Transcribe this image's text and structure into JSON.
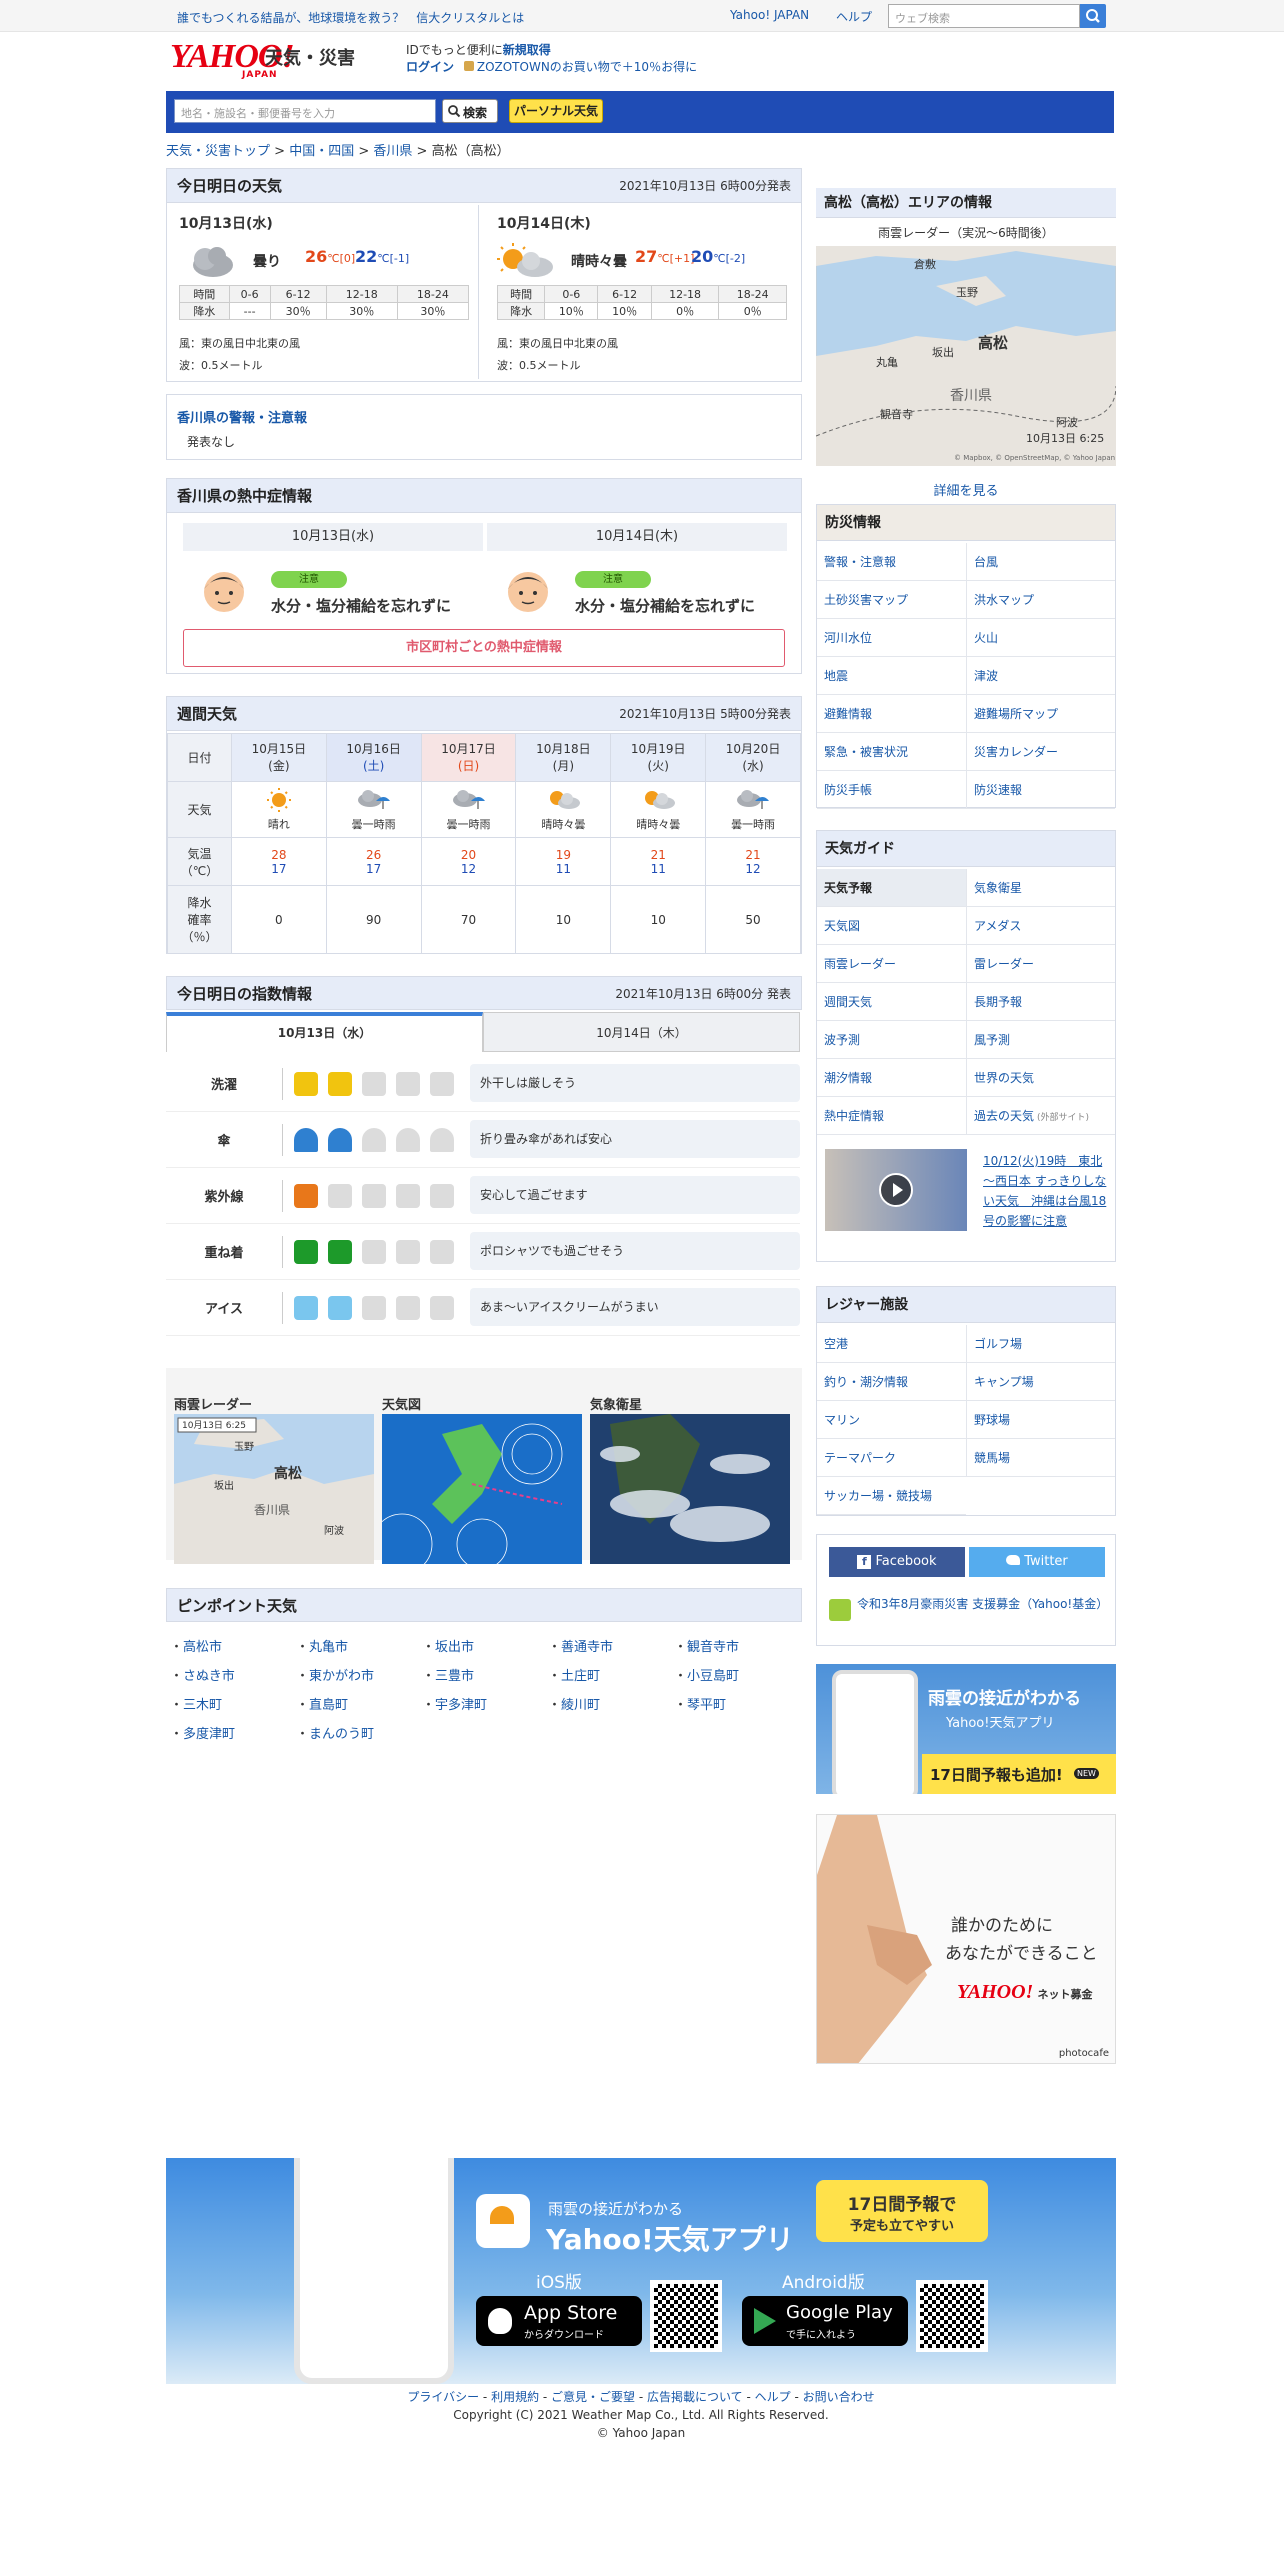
{
  "topbar": {
    "promo": "誰でもつくれる結晶が、地球環境を救う？　信大クリスタルとは",
    "yahoo_japan": "Yahoo! JAPAN",
    "help": "ヘルプ",
    "search_placeholder": "ウェブ検索"
  },
  "header": {
    "logo_text": "YAHOO!",
    "logo_sub": "JAPAN",
    "service": "天気・災害",
    "id_line1_a": "IDでもっと便利に",
    "id_line1_b": "新規取得",
    "login": "ログイン",
    "zozo": "ZOZOTOWNのお買い物で＋10％お得に"
  },
  "searchbar": {
    "placeholder": "地名・施設名・郵便番号を入力",
    "button": "検索",
    "personal": "パーソナル天気"
  },
  "breadcrumb": [
    "天気・災害トップ",
    "中国・四国",
    "香川県",
    "高松（高松）"
  ],
  "today_panel": {
    "title": "今日明日の天気",
    "stamp": "2021年10月13日 6時00分発表",
    "days": [
      {
        "date": "10月13日(水)",
        "cond": "曇り",
        "hi": "26",
        "hi_diff": "℃[0]",
        "lo": "22",
        "lo_diff": "℃[-1]",
        "periods": [
          "時間",
          "0-6",
          "6-12",
          "12-18",
          "18-24"
        ],
        "rain": [
          "降水",
          "---",
          "30％",
          "30％",
          "30％"
        ],
        "wind": "風：東の風日中北東の風",
        "wave": "波：0.5メートル"
      },
      {
        "date": "10月14日(木)",
        "cond": "晴時々曇",
        "hi": "27",
        "hi_diff": "℃[+1]",
        "lo": "20",
        "lo_diff": "℃[-2]",
        "periods": [
          "時間",
          "0-6",
          "6-12",
          "12-18",
          "18-24"
        ],
        "rain": [
          "降水",
          "10％",
          "10％",
          "0％",
          "0％"
        ],
        "wind": "風：東の風日中北東の風",
        "wave": "波：0.5メートル"
      }
    ]
  },
  "warning": {
    "title": "香川県の警報・注意報",
    "text": "発表なし"
  },
  "heat": {
    "title": "香川県の熱中症情報",
    "days": [
      {
        "date": "10月13日(水)",
        "level": "注意",
        "msg": "水分・塩分補給を忘れずに"
      },
      {
        "date": "10月14日(木)",
        "level": "注意",
        "msg": "水分・塩分補給を忘れずに"
      }
    ],
    "link": "市区町村ごとの熱中症情報"
  },
  "weekly": {
    "title": "週間天気",
    "stamp": "2021年10月13日 5時00分発表",
    "labels": {
      "date": "日付",
      "weather": "天気",
      "temp1": "気温",
      "temp2": "（℃）",
      "rain1": "降水",
      "rain2": "確率",
      "rain3": "（％）"
    },
    "days": [
      {
        "date": "10月15日",
        "dow": "(金)",
        "w": "晴れ",
        "hi": "28",
        "lo": "17",
        "rain": "0",
        "icon": "sun"
      },
      {
        "date": "10月16日",
        "dow": "(土)",
        "w": "曇一時雨",
        "hi": "26",
        "lo": "17",
        "rain": "90",
        "icon": "cloudrain"
      },
      {
        "date": "10月17日",
        "dow": "(日)",
        "w": "曇一時雨",
        "hi": "20",
        "lo": "12",
        "rain": "70",
        "icon": "cloudrain"
      },
      {
        "date": "10月18日",
        "dow": "(月)",
        "w": "晴時々曇",
        "hi": "19",
        "lo": "11",
        "rain": "10",
        "icon": "suncloud"
      },
      {
        "date": "10月19日",
        "dow": "(火)",
        "w": "晴時々曇",
        "hi": "21",
        "lo": "11",
        "rain": "10",
        "icon": "suncloud"
      },
      {
        "date": "10月20日",
        "dow": "(水)",
        "w": "曇一時雨",
        "hi": "21",
        "lo": "12",
        "rain": "50",
        "icon": "cloudrain"
      }
    ]
  },
  "index": {
    "title": "今日明日の指数情報",
    "stamp": "2021年10月13日 6時00分 発表",
    "tabs": [
      "10月13日（水）",
      "10月14日（木）"
    ],
    "rows": [
      {
        "name": "洗濯",
        "level": 2,
        "text": "外干しは厳しそう",
        "color": "#f1c40f",
        "icon": "shirt-icon"
      },
      {
        "name": "傘",
        "level": 2,
        "text": "折り畳み傘があれば安心",
        "color": "#2f80d0",
        "icon": "umbrella-icon"
      },
      {
        "name": "紫外線",
        "level": 1,
        "text": "安心して過ごせます",
        "color": "#e8771a",
        "icon": "uv-icon"
      },
      {
        "name": "重ね着",
        "level": 2,
        "text": "ポロシャツでも過ごせそう",
        "color": "#1d9a2a",
        "icon": "sweater-icon"
      },
      {
        "name": "アイス",
        "level": 2,
        "text": "あま～いアイスクリームがうまい",
        "color": "#7ac6ee",
        "icon": "icecream-icon"
      }
    ]
  },
  "maps": {
    "radar": "雨雲レーダー",
    "chart": "天気図",
    "sat": "気象衛星",
    "radar_stamp": "10月13日 6:25",
    "radar_places": [
      "玉野",
      "高松",
      "坂出",
      "香川県",
      "阿波"
    ]
  },
  "pinpoint": {
    "title": "ピンポイント天気",
    "cities": [
      "高松市",
      "丸亀市",
      "坂出市",
      "善通寺市",
      "観音寺市",
      "さぬき市",
      "東かがわ市",
      "三豊市",
      "土庄町",
      "小豆島町",
      "三木町",
      "直島町",
      "宇多津町",
      "綾川町",
      "琴平町",
      "多度津町",
      "まんのう町"
    ]
  },
  "area": {
    "title": "高松（高松）エリアの情報",
    "radar_label": "雨雲レーダー（実況～6時間後）",
    "places": [
      "倉敷",
      "玉野",
      "高松",
      "丸亀",
      "坂出",
      "香川県",
      "観音寺",
      "阿波"
    ],
    "stamp": "10月13日 6:25",
    "credit": "© Mapbox, © OpenStreetMap, © Yahoo Japan",
    "detail": "詳細を見る"
  },
  "bousai": {
    "title": "防災情報",
    "items": [
      "警報・注意報",
      "台風",
      "土砂災害マップ",
      "洪水マップ",
      "河川水位",
      "火山",
      "地震",
      "津波",
      "避難情報",
      "避難場所マップ",
      "緊急・被害状況",
      "災害カレンダー",
      "防災手帳",
      "防災速報"
    ]
  },
  "guide": {
    "title": "天気ガイド",
    "items": [
      "天気予報",
      "気象衛星",
      "天気図",
      "アメダス",
      "雨雲レーダー",
      "雷レーダー",
      "週間天気",
      "長期予報",
      "波予測",
      "風予測",
      "潮汐情報",
      "世界の天気",
      "熱中症情報",
      "過去の天気"
    ],
    "external": "(外部サイト)",
    "video": "10/12(火)19時　東北～西日本 すっきりしない天気　沖縄は台風18号の影響に注意"
  },
  "leisure": {
    "title": "レジャー施設",
    "items": [
      "空港",
      "ゴルフ場",
      "釣り・潮汐情報",
      "キャンプ場",
      "マリン",
      "野球場",
      "テーマパーク",
      "競馬場",
      "サッカー場・競技場"
    ]
  },
  "social": {
    "facebook": "Facebook",
    "twitter": "Twitter",
    "donate": "令和3年8月豪雨災害 支援募金（Yahoo!基金）"
  },
  "ad1": {
    "line1": "雨雲の接近がわかる",
    "line2": "Yahoo!天気アプリ",
    "line3": "17日間予報も追加!",
    "new": "NEW"
  },
  "ad2": {
    "line1": "誰かのために",
    "line2": "あなたができること",
    "brand": "YAHOO!",
    "brand2": "ネット募金",
    "credit": "photocafe"
  },
  "appbanner": {
    "sub": "雨雲の接近がわかる",
    "title": "Yahoo!天気アプリ",
    "badge1": "17日間予報で",
    "badge2": "予定も立てやすい",
    "ios": "iOS版",
    "android": "Android版",
    "appstore1": "App Store",
    "appstore2": "からダウンロード",
    "gplay1": "Google Play",
    "gplay2": "で手に入れよう"
  },
  "footer": {
    "links": [
      "プライバシー",
      "利用規約",
      "ご意見・ご要望",
      "広告掲載について",
      "ヘルプ",
      "お問い合わせ"
    ],
    "copy1": "Copyright (C) 2021 Weather Map Co., Ltd. All Rights Reserved.",
    "copy2": "© Yahoo Japan"
  }
}
